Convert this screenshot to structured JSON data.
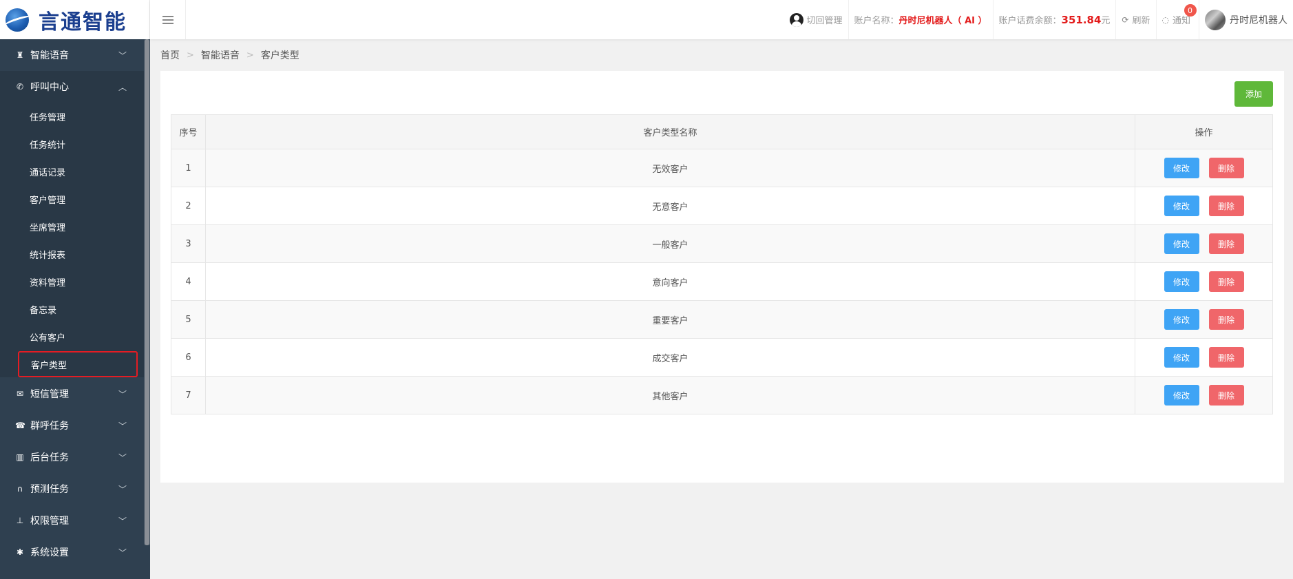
{
  "brand": {
    "logo_text": "言通智能"
  },
  "header": {
    "switch_manage": "切回管理",
    "account_label": "账户名称：",
    "account_name": "丹时尼机器人（ AI ）",
    "balance_label": "账户话费余额：",
    "balance_value": "351.84",
    "balance_unit": "元",
    "refresh": "刷新",
    "notify": "通知",
    "notify_count": "0",
    "username": "丹时尼机器人"
  },
  "sidebar": {
    "groups": [
      {
        "label": "智能语音",
        "icon": "robot-icon"
      },
      {
        "label": "呼叫中心",
        "icon": "phone-icon"
      },
      {
        "label": "短信管理",
        "icon": "envelope-icon"
      },
      {
        "label": "群呼任务",
        "icon": "telephone-icon"
      },
      {
        "label": "后台任务",
        "icon": "bar-chart-icon"
      },
      {
        "label": "预测任务",
        "icon": "binoculars-icon"
      },
      {
        "label": "权限管理",
        "icon": "sitemap-icon"
      },
      {
        "label": "系统设置",
        "icon": "gear-icon"
      }
    ],
    "sub_items": [
      "任务管理",
      "任务统计",
      "通话记录",
      "客户管理",
      "坐席管理",
      "统计报表",
      "资料管理",
      "备忘录",
      "公有客户",
      "客户类型"
    ]
  },
  "breadcrumb": [
    "首页",
    "智能语音",
    "客户类型"
  ],
  "toolbar": {
    "add_label": "添加"
  },
  "table": {
    "headers": [
      "序号",
      "客户类型名称",
      "操作"
    ],
    "rows": [
      {
        "idx": "1",
        "name": "无效客户"
      },
      {
        "idx": "2",
        "name": "无意客户"
      },
      {
        "idx": "3",
        "name": "一般客户"
      },
      {
        "idx": "4",
        "name": "意向客户"
      },
      {
        "idx": "5",
        "name": "重要客户"
      },
      {
        "idx": "6",
        "name": "成交客户"
      },
      {
        "idx": "7",
        "name": "其他客户"
      }
    ],
    "edit_label": "修改",
    "delete_label": "删除"
  },
  "colors": {
    "sidebar_bg": "#2f4050",
    "add_green": "#5fb83a",
    "edit_blue": "#3fa4f5",
    "delete_red": "#f0666a",
    "highlight_red": "#e51c23"
  }
}
